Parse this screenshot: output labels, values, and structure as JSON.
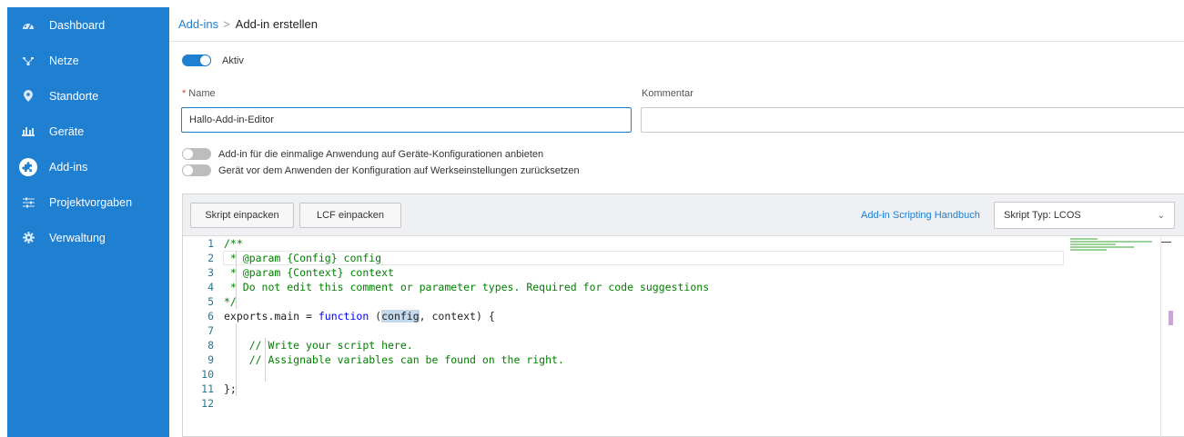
{
  "sidebar": {
    "items": [
      {
        "label": "Dashboard",
        "icon": "dashboard-gauge-icon"
      },
      {
        "label": "Netze",
        "icon": "network-icon"
      },
      {
        "label": "Standorte",
        "icon": "location-pin-icon"
      },
      {
        "label": "Geräte",
        "icon": "devices-icon"
      },
      {
        "label": "Add-ins",
        "icon": "puzzle-icon"
      },
      {
        "label": "Projektvorgaben",
        "icon": "sliders-icon"
      },
      {
        "label": "Verwaltung",
        "icon": "gear-icon"
      }
    ]
  },
  "breadcrumb": {
    "parent": "Add-ins",
    "separator": ">",
    "current": "Add-in erstellen"
  },
  "form": {
    "aktiv_label": "Aktiv",
    "aktiv_on": true,
    "name_required_mark": "*",
    "name_label": "Name",
    "name_value": "Hallo-Add-in-Editor",
    "kommentar_label": "Kommentar",
    "kommentar_value": "",
    "option1_label": "Add-in für die einmalige Anwendung auf Geräte-Konfigurationen anbieten",
    "option2_label": "Gerät vor dem Anwenden der Konfiguration auf Werkseinstellungen zurücksetzen"
  },
  "editor": {
    "btn_pack_script": "Skript einpacken",
    "btn_pack_lcf": "LCF einpacken",
    "handbook_link": "Add-in Scripting Handbuch",
    "script_type": "Skript Typ: LCOS",
    "lines": [
      {
        "n": "1",
        "text": "/**"
      },
      {
        "n": "2",
        "text": " * @param {Config} config"
      },
      {
        "n": "3",
        "text": " * @param {Context} context"
      },
      {
        "n": "4",
        "text": " * Do not edit this comment or parameter types. Required for code suggestions"
      },
      {
        "n": "5",
        "text": "*/"
      },
      {
        "n": "6",
        "pre": "exports.main = ",
        "kw": "function",
        "mid": " (",
        "hl": "config",
        "post": ", context) {"
      },
      {
        "n": "7",
        "text": ""
      },
      {
        "n": "8",
        "text": "    // Write your script here."
      },
      {
        "n": "9",
        "text": "    // Assignable variables can be found on the right."
      },
      {
        "n": "10",
        "text": ""
      },
      {
        "n": "11",
        "text": "};"
      },
      {
        "n": "12",
        "text": ""
      }
    ]
  },
  "colors": {
    "sidebar_bg": "#1f7fd1",
    "link": "#1f7fd1",
    "comment": "#008000",
    "keyword": "#0000ff"
  }
}
